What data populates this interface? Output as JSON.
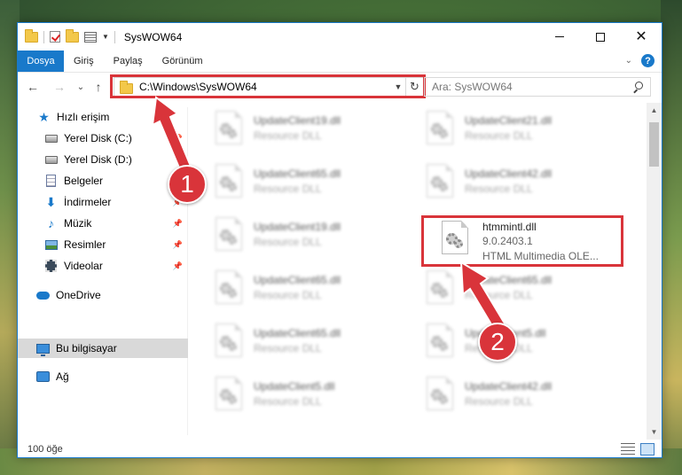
{
  "window": {
    "title": "SysWOW64"
  },
  "ribbon": {
    "tabs": [
      "Dosya",
      "Giriş",
      "Paylaş",
      "Görünüm"
    ],
    "help_label": "?"
  },
  "nav": {
    "back_icon": "←",
    "forward_icon": "→",
    "recent_icon": "⌄",
    "up_icon": "↑",
    "address": "C:\\Windows\\SysWOW64",
    "refresh_icon": "↻",
    "search_placeholder": "Ara: SysWOW64"
  },
  "sidebar": {
    "items": [
      {
        "label": "Hızlı erişim",
        "icon": "star-icon",
        "glyph": "★"
      },
      {
        "label": "Yerel Disk (C:)",
        "icon": "disk-icon",
        "glyph": ""
      },
      {
        "label": "Yerel Disk (D:)",
        "icon": "disk-icon",
        "glyph": ""
      },
      {
        "label": "Belgeler",
        "icon": "document-icon",
        "glyph": ""
      },
      {
        "label": "İndirmeler",
        "icon": "download-icon",
        "glyph": "⬇"
      },
      {
        "label": "Müzik",
        "icon": "music-icon",
        "glyph": "♪"
      },
      {
        "label": "Resimler",
        "icon": "pictures-icon",
        "glyph": ""
      },
      {
        "label": "Videolar",
        "icon": "videos-icon",
        "glyph": ""
      },
      {
        "label": "OneDrive",
        "icon": "cloud-icon",
        "glyph": ""
      },
      {
        "label": "Bu bilgisayar",
        "icon": "computer-icon",
        "glyph": ""
      },
      {
        "label": "Ağ",
        "icon": "network-icon",
        "glyph": ""
      }
    ]
  },
  "files": [
    {
      "name": "UpdateClient19.dll",
      "type": "Resource DLL"
    },
    {
      "name": "UpdateClient21.dll",
      "type": "Resource DLL"
    },
    {
      "name": "UpdateClient65.dll",
      "type": "Resource DLL"
    },
    {
      "name": "UpdateClient42.dll",
      "type": "Resource DLL"
    },
    {
      "name": "UpdateClient19.dll",
      "type": "Resource DLL"
    },
    {
      "name": "htmmintl.dll",
      "version": "9.0.2403.1",
      "description": "HTML Multimedia OLE..."
    },
    {
      "name": "UpdateClient65.dll",
      "type": "Resource DLL"
    },
    {
      "name": "UpdateClient65.dll",
      "type": "Resource DLL"
    },
    {
      "name": "UpdateClient65.dll",
      "type": "Resource DLL"
    },
    {
      "name": "UpdateClient5.dll",
      "type": "Resource DLL"
    },
    {
      "name": "UpdateClient5.dll",
      "type": "Resource DLL"
    },
    {
      "name": "UpdateClient42.dll",
      "type": "Resource DLL"
    }
  ],
  "status": {
    "item_count": "100 öğe"
  },
  "callouts": {
    "one": "1",
    "two": "2"
  },
  "colors": {
    "accent": "#1979ca",
    "highlight": "#d9343a"
  }
}
